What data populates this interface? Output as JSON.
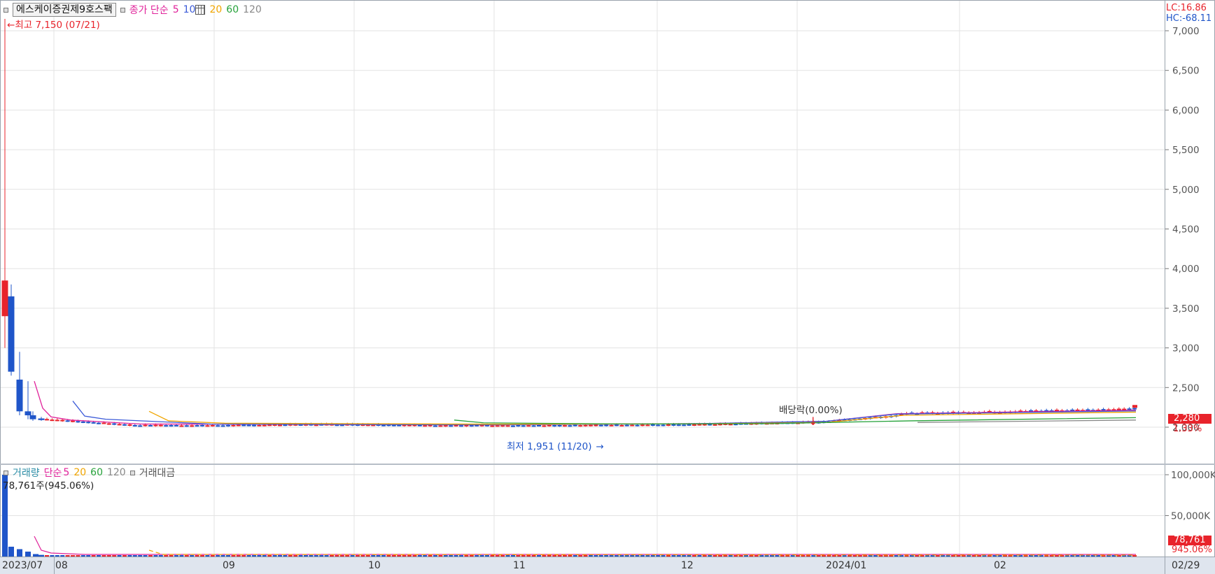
{
  "stock": {
    "name": "에스케이증권제9호스팩"
  },
  "price_legend": {
    "series_label": "종가 단순",
    "ma": [
      "5",
      "10",
      "20",
      "60",
      "120"
    ],
    "ma_colors": [
      "#e0219a",
      "#3c5bd8",
      "#f0a500",
      "#26a23a",
      "#888888"
    ]
  },
  "volume_legend": {
    "label": "거래량",
    "simple": "단순",
    "ma": [
      "5",
      "20",
      "60",
      "120"
    ],
    "amount_label": "거래대금"
  },
  "annotations": {
    "high": "최고 7,150 (07/21)",
    "low": "최저 1,951 (11/20)",
    "dividend": "배당락(0.00%)",
    "volume_peak": "78,761주(945.06%)"
  },
  "right_info": {
    "lc": "LC:16.86",
    "hc": "HC:-68.11",
    "last_price": "2,280",
    "change_pct": "1.33%",
    "last_volume": "78,761",
    "volume_pct": "945.06%"
  },
  "price_axis": {
    "ticks": [
      "7,000",
      "6,500",
      "6,000",
      "5,500",
      "5,000",
      "4,500",
      "4,000",
      "3,500",
      "3,000",
      "2,500",
      "2,000"
    ],
    "values": [
      7000,
      6500,
      6000,
      5500,
      5000,
      4500,
      4000,
      3500,
      3000,
      2500,
      2000
    ]
  },
  "volume_axis": {
    "ticks": [
      "100,000K",
      "50,000K"
    ],
    "values": [
      100000,
      50000
    ]
  },
  "date_axis": {
    "labels": [
      "2023/07",
      "08",
      "09",
      "10",
      "11",
      "12",
      "2024/01",
      "02",
      "02/29"
    ]
  },
  "colors": {
    "up": "#e8232b",
    "down": "#1f55c9",
    "grid": "#e3e3e3",
    "accent_red": "#e8232b",
    "accent_blue": "#1f55c9"
  },
  "chart_data": {
    "type": "candlestick",
    "ylim": [
      1800,
      7300
    ],
    "highlights": {
      "high": 7150,
      "low": 1951,
      "last": 2280
    },
    "candles": [
      {
        "o": 3400,
        "h": 7150,
        "l": 3000,
        "c": 3850
      },
      {
        "o": 3650,
        "h": 3800,
        "l": 2650,
        "c": 2700
      },
      {
        "o": 2600,
        "h": 2950,
        "l": 2150,
        "c": 2200
      },
      {
        "o": 2200,
        "h": 2580,
        "l": 2100,
        "c": 2150
      },
      {
        "o": 2150,
        "h": 2200,
        "l": 2080,
        "c": 2100
      },
      {
        "o": 2110,
        "h": 2130,
        "l": 2080,
        "c": 2090
      }
    ],
    "volume_peak": 78761
  }
}
